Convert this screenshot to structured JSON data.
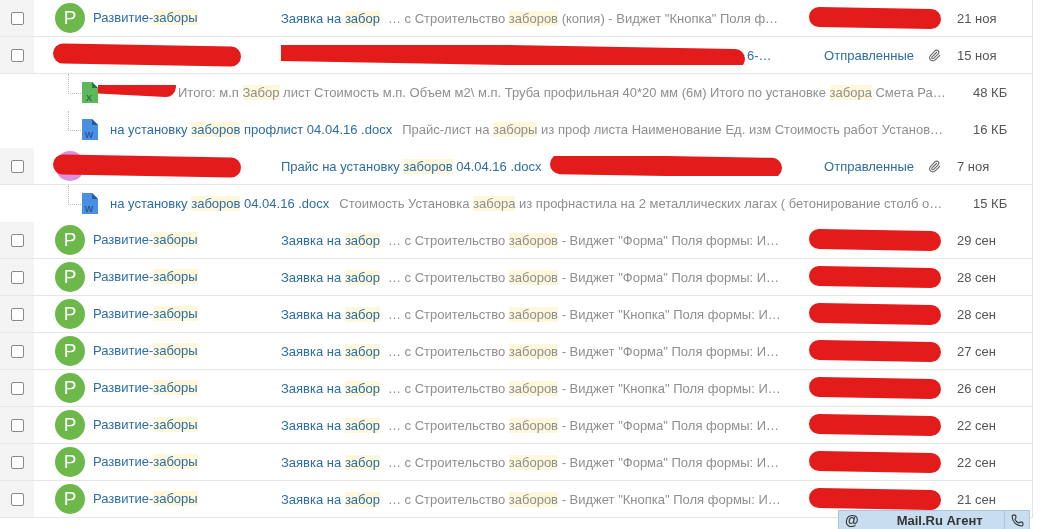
{
  "rows": [
    {
      "kind": "message",
      "checked": false,
      "avatar": {
        "letter": "Р",
        "color": "#6cb84a"
      },
      "sender": [
        {
          "text": "Развитие-"
        },
        {
          "text": "заборы",
          "highlight": true
        }
      ],
      "subject": [
        {
          "text": "Заявка на "
        },
        {
          "text": "забор",
          "highlight": true
        }
      ],
      "snippet": [
        {
          "text": "… с Строительство "
        },
        {
          "text": "заборов",
          "highlight": true
        },
        {
          "text": " (копия) - Виджет \"Кнопка\" Поля ф…"
        }
      ],
      "correspondent_redacted": true,
      "date": "21 ноя"
    },
    {
      "kind": "message",
      "checked": false,
      "sender_redacted": true,
      "subject_redacted": true,
      "subject": [
        {
          "text": "6-…"
        }
      ],
      "folder": "Отправленные",
      "attachment": true,
      "date": "15 ноя"
    },
    {
      "kind": "file",
      "icon": {
        "kind": "excel",
        "letter": "X"
      },
      "name_redacted": true,
      "snippet": [
        {
          "text": "Итого: м.п "
        },
        {
          "text": "Забор",
          "highlight": true
        },
        {
          "text": " лист Стоимость м.п. Объем м2\\ м.п. Труба профильная 40*20 мм (6м) Итого по установке "
        },
        {
          "text": "забора",
          "highlight": true
        },
        {
          "text": " Смета Ра…"
        }
      ],
      "size": "48 КБ"
    },
    {
      "kind": "file",
      "icon": {
        "kind": "word",
        "letter": "W"
      },
      "name": [
        {
          "text": "на установку "
        },
        {
          "text": "заборов",
          "highlight": true
        },
        {
          "text": " профлист 04.04.16 .docx"
        }
      ],
      "snippet": [
        {
          "text": "Прайс-лист на "
        },
        {
          "text": "заборы",
          "highlight": true
        },
        {
          "text": " из проф листа Наименование Ед. изм Стоимость работ Установ…"
        }
      ],
      "size": "16 КБ"
    },
    {
      "kind": "message",
      "checked": false,
      "avatar": {
        "color": "#de8fdc"
      },
      "sender_redacted": true,
      "subject": [
        {
          "text": "Прайс на установку "
        },
        {
          "text": "заборов",
          "highlight": true
        },
        {
          "text": " 04.04.16 .docx"
        }
      ],
      "snippet_redacted": true,
      "folder": "Отправленные",
      "attachment": true,
      "date": "7 ноя"
    },
    {
      "kind": "file",
      "icon": {
        "kind": "word",
        "letter": "W"
      },
      "name": [
        {
          "text": "на установку "
        },
        {
          "text": "заборов",
          "highlight": true
        },
        {
          "text": " 04.04.16 .docx"
        }
      ],
      "snippet": [
        {
          "text": "Стоимость Установка "
        },
        {
          "text": "забора",
          "highlight": true
        },
        {
          "text": " из профнастила на 2 металлических лагах ( бетонирование столб о…"
        }
      ],
      "size": "15 КБ"
    },
    {
      "kind": "message",
      "checked": false,
      "avatar": {
        "letter": "Р",
        "color": "#6cb84a"
      },
      "sender": [
        {
          "text": "Развитие-"
        },
        {
          "text": "заборы",
          "highlight": true
        }
      ],
      "subject": [
        {
          "text": "Заявка на "
        },
        {
          "text": "забор",
          "highlight": true
        }
      ],
      "snippet": [
        {
          "text": "… с Строительство "
        },
        {
          "text": "заборов",
          "highlight": true
        },
        {
          "text": " - Виджет \"Форма\" Поля формы: И…"
        }
      ],
      "correspondent_redacted": true,
      "date": "29 сен"
    },
    {
      "kind": "message",
      "checked": false,
      "avatar": {
        "letter": "Р",
        "color": "#6cb84a"
      },
      "sender": [
        {
          "text": "Развитие-"
        },
        {
          "text": "заборы",
          "highlight": true
        }
      ],
      "subject": [
        {
          "text": "Заявка на "
        },
        {
          "text": "забор",
          "highlight": true
        }
      ],
      "snippet": [
        {
          "text": "… с Строительство "
        },
        {
          "text": "заборов",
          "highlight": true
        },
        {
          "text": " - Виджет \"Форма\" Поля формы: И…"
        }
      ],
      "correspondent_redacted": true,
      "date": "28 сен"
    },
    {
      "kind": "message",
      "checked": false,
      "avatar": {
        "letter": "Р",
        "color": "#6cb84a"
      },
      "sender": [
        {
          "text": "Развитие-"
        },
        {
          "text": "заборы",
          "highlight": true
        }
      ],
      "subject": [
        {
          "text": "Заявка на "
        },
        {
          "text": "забор",
          "highlight": true
        }
      ],
      "snippet": [
        {
          "text": "… с Строительство "
        },
        {
          "text": "заборов",
          "highlight": true
        },
        {
          "text": " - Виджет \"Кнопка\" Поля формы: И…"
        }
      ],
      "correspondent_redacted": true,
      "date": "28 сен"
    },
    {
      "kind": "message",
      "checked": false,
      "avatar": {
        "letter": "Р",
        "color": "#6cb84a"
      },
      "sender": [
        {
          "text": "Развитие-"
        },
        {
          "text": "заборы",
          "highlight": true
        }
      ],
      "subject": [
        {
          "text": "Заявка на "
        },
        {
          "text": "забор",
          "highlight": true
        }
      ],
      "snippet": [
        {
          "text": "… с Строительство "
        },
        {
          "text": "заборов",
          "highlight": true
        },
        {
          "text": " - Виджет \"Форма\" Поля формы: И…"
        }
      ],
      "correspondent_redacted": true,
      "date": "27 сен"
    },
    {
      "kind": "message",
      "checked": false,
      "avatar": {
        "letter": "Р",
        "color": "#6cb84a"
      },
      "sender": [
        {
          "text": "Развитие-"
        },
        {
          "text": "заборы",
          "highlight": true
        }
      ],
      "subject": [
        {
          "text": "Заявка на "
        },
        {
          "text": "забор",
          "highlight": true
        }
      ],
      "snippet": [
        {
          "text": "… с Строительство "
        },
        {
          "text": "заборов",
          "highlight": true
        },
        {
          "text": " - Виджет \"Кнопка\" Поля формы: И…"
        }
      ],
      "correspondent_redacted": true,
      "date": "26 сен"
    },
    {
      "kind": "message",
      "checked": false,
      "avatar": {
        "letter": "Р",
        "color": "#6cb84a"
      },
      "sender": [
        {
          "text": "Развитие-"
        },
        {
          "text": "заборы",
          "highlight": true
        }
      ],
      "subject": [
        {
          "text": "Заявка на "
        },
        {
          "text": "забор",
          "highlight": true
        }
      ],
      "snippet": [
        {
          "text": "… с Строительство "
        },
        {
          "text": "заборов",
          "highlight": true
        },
        {
          "text": " - Виджет \"Форма\" Поля формы: И…"
        }
      ],
      "correspondent_redacted": true,
      "date": "22 сен"
    },
    {
      "kind": "message",
      "checked": false,
      "avatar": {
        "letter": "Р",
        "color": "#6cb84a"
      },
      "sender": [
        {
          "text": "Развитие-"
        },
        {
          "text": "заборы",
          "highlight": true
        }
      ],
      "subject": [
        {
          "text": "Заявка на "
        },
        {
          "text": "забор",
          "highlight": true
        }
      ],
      "snippet": [
        {
          "text": "… с Строительство "
        },
        {
          "text": "заборов",
          "highlight": true
        },
        {
          "text": " - Виджет \"Форма\" Поля формы: И…"
        }
      ],
      "correspondent_redacted": true,
      "date": "22 сен"
    },
    {
      "kind": "message",
      "checked": false,
      "avatar": {
        "letter": "Р",
        "color": "#6cb84a"
      },
      "sender": [
        {
          "text": "Развитие-"
        },
        {
          "text": "заборы",
          "highlight": true
        }
      ],
      "subject": [
        {
          "text": "Заявка на "
        },
        {
          "text": "забор",
          "highlight": true
        }
      ],
      "snippet": [
        {
          "text": "… с Строительство "
        },
        {
          "text": "заборов",
          "highlight": true
        },
        {
          "text": " - Виджет \"Кнопка\" Поля формы: И…"
        }
      ],
      "correspondent_redacted": true,
      "date": "21 сен"
    }
  ],
  "agent_bar": {
    "icon": "@",
    "title": "Mail.Ru Агент"
  }
}
